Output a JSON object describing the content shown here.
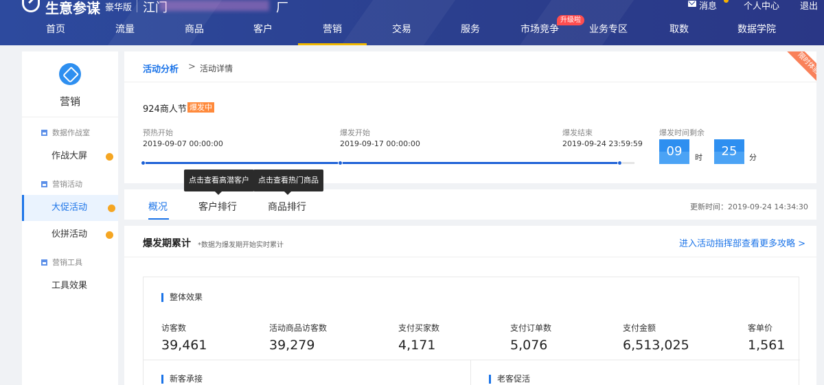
{
  "header": {
    "brand": "生意参谋",
    "edition": "豪华版",
    "shop_prefix": "江门",
    "shop_suffix": "厂",
    "messages_label": "消息",
    "profile_label": "个人中心",
    "logout_label": "退出"
  },
  "nav": {
    "items": [
      "首页",
      "流量",
      "商品",
      "客户",
      "营销",
      "交易",
      "服务",
      "市场竞争",
      "业务专区",
      "取数",
      "数据学院"
    ],
    "badge": "升级啦",
    "active": "营销"
  },
  "sidebar": {
    "title": "营销",
    "groups": [
      "数据作战室",
      "营销活动",
      "营销工具"
    ],
    "items": [
      "作战大屏",
      "大促活动",
      "伙拼活动",
      "工具效果"
    ]
  },
  "breadcrumb": {
    "parent": "活动分析",
    "separator": ">",
    "current": "活动详情",
    "ribbon": "限时体验"
  },
  "event": {
    "name": "924商人节",
    "status": "爆发中",
    "stages": [
      {
        "label": "预热开始",
        "time": "2019-09-07 00:00:00"
      },
      {
        "label": "爆发开始",
        "time": "2019-09-17 00:00:00"
      },
      {
        "label": "爆发结束",
        "time": "2019-09-24 23:59:59"
      }
    ],
    "progress": 0.97,
    "countdown_label": "爆发时间剩余",
    "hours": "09",
    "hours_unit": "时",
    "minutes": "25",
    "minutes_unit": "分"
  },
  "tooltips": [
    "点击查看高潜客户",
    "点击查看热门商品"
  ],
  "tabs": {
    "items": [
      "概况",
      "客户排行",
      "商品排行"
    ],
    "update_time": "更新时间：2019-09-24 14:34:30"
  },
  "section": {
    "title": "爆发期累计",
    "note": "*数据为爆发期开始实时累计",
    "link": "进入活动指挥部查看更多攻略 >",
    "overall_title": "整体效果",
    "metrics": [
      {
        "label": "访客数",
        "value": "39,461"
      },
      {
        "label": "活动商品访客数",
        "value": "39,279"
      },
      {
        "label": "支付买家数",
        "value": "4,171"
      },
      {
        "label": "支付订单数",
        "value": "5,076"
      },
      {
        "label": "支付金额",
        "value": "6,513,025"
      },
      {
        "label": "客单价",
        "value": "1,561"
      }
    ],
    "new_title": "新客承接",
    "old_title": "老客促活"
  }
}
